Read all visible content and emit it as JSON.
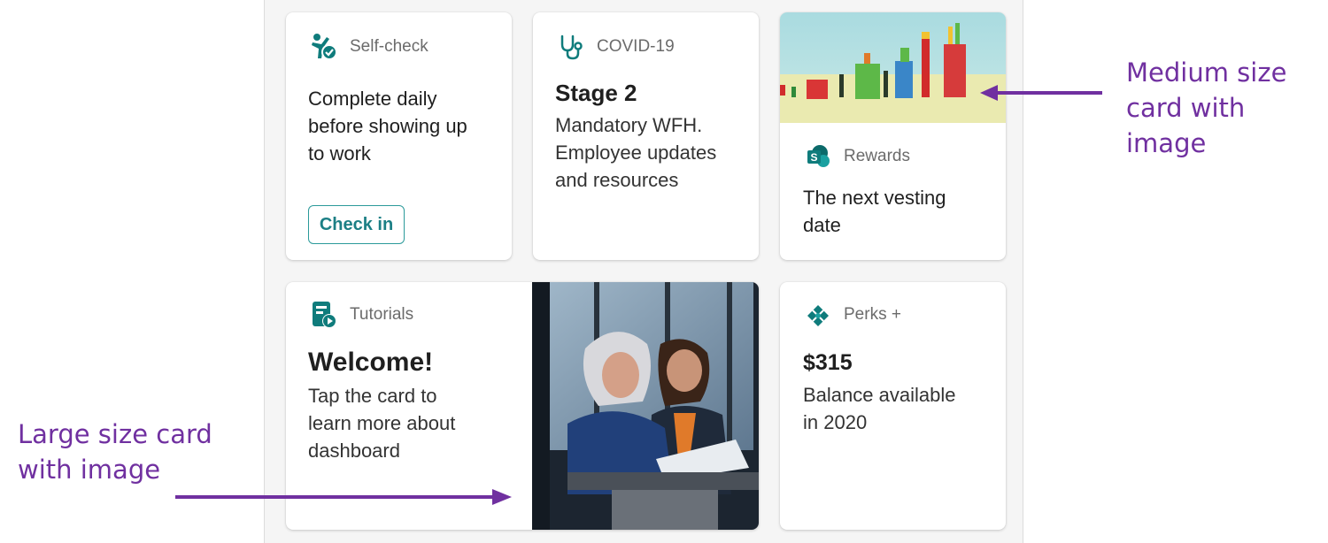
{
  "cards": {
    "self_check": {
      "label": "Self-check",
      "title_lines": [
        "Complete daily",
        "before showing up",
        "to work"
      ],
      "button_label": "Check in"
    },
    "covid": {
      "label": "COVID-19",
      "title": "Stage 2",
      "body_lines": [
        "Mandatory WFH.",
        "Employee updates",
        "and resources"
      ]
    },
    "rewards": {
      "label": "Rewards",
      "title_lines": [
        "The next vesting",
        "date"
      ]
    },
    "tutorials": {
      "label": "Tutorials",
      "title": "Welcome!",
      "body_lines": [
        "Tap the card to",
        "learn more about",
        "dashboard"
      ]
    },
    "perks": {
      "label": "Perks +",
      "title": "$315",
      "body_lines": [
        "Balance available",
        "in 2020"
      ]
    }
  },
  "annotations": {
    "medium": [
      "Medium size",
      "card with",
      "image"
    ],
    "large": [
      "Large size card",
      "with image"
    ]
  },
  "colors": {
    "accent_teal": "#0f7c7c",
    "annotation_purple": "#7030a0"
  }
}
